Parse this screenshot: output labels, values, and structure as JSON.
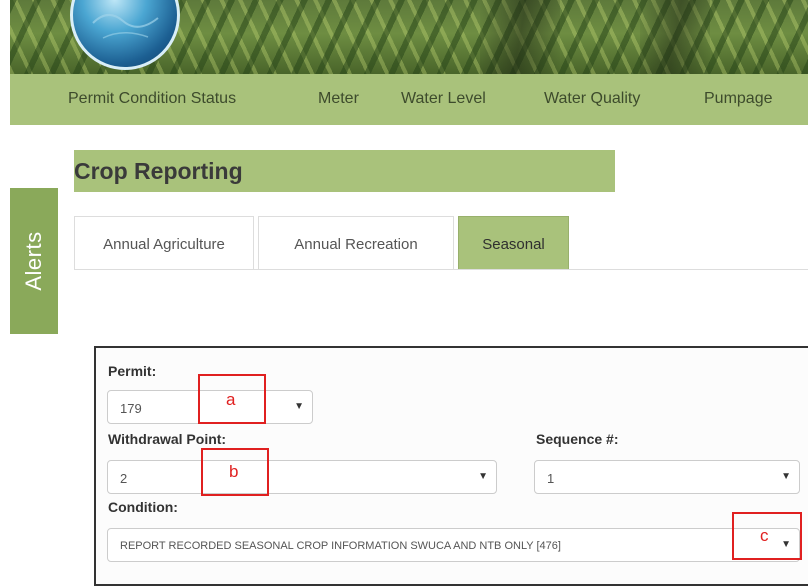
{
  "nav": {
    "items": [
      "Permit Condition Status",
      "Meter",
      "Water Level",
      "Water Quality",
      "Pumpage"
    ]
  },
  "sidebar": {
    "alerts_label": "Alerts"
  },
  "page": {
    "title": "Crop Reporting"
  },
  "tabs": [
    {
      "label": "Annual Agriculture",
      "active": false
    },
    {
      "label": "Annual Recreation",
      "active": false
    },
    {
      "label": "Seasonal",
      "active": true
    }
  ],
  "form": {
    "permit": {
      "label": "Permit:",
      "value": "179"
    },
    "withdrawal_point": {
      "label": "Withdrawal Point:",
      "value": "2"
    },
    "sequence": {
      "label": "Sequence #:",
      "value": "1"
    },
    "condition": {
      "label": "Condition:",
      "value": "REPORT RECORDED SEASONAL CROP INFORMATION SWUCA AND NTB ONLY [476]"
    }
  },
  "annotations": [
    "a",
    "b",
    "c"
  ],
  "colors": {
    "nav_green": "#a9c27b",
    "alerts_green": "#8aa95a",
    "annotation_red": "#e02020"
  }
}
